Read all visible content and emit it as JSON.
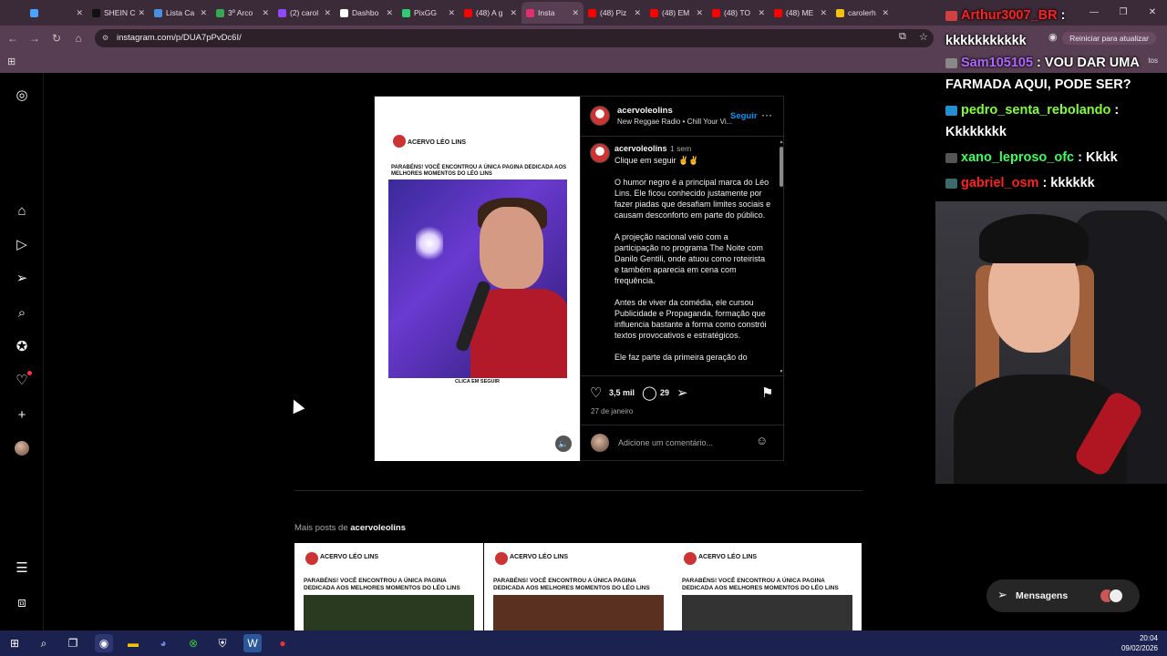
{
  "browser": {
    "tabs": [
      {
        "label": "",
        "color": "#4aa3ff",
        "active": false
      },
      {
        "label": "SHEIN C",
        "color": "#111111",
        "active": false
      },
      {
        "label": "Lista Ca",
        "color": "#4a90e2",
        "active": false
      },
      {
        "label": "3º Arco",
        "color": "#34a853",
        "active": false
      },
      {
        "label": "(2) carol",
        "color": "#9146ff",
        "active": false
      },
      {
        "label": "Dashbo",
        "color": "#ffffff",
        "active": false
      },
      {
        "label": "PixGG",
        "color": "#2ecc71",
        "active": false
      },
      {
        "label": "(48) A g",
        "color": "#ff0000",
        "active": false
      },
      {
        "label": "Insta",
        "color": "#e1306c",
        "active": true
      },
      {
        "label": "(48) Piz",
        "color": "#ff0000",
        "active": false
      },
      {
        "label": "(48) EM",
        "color": "#ff0000",
        "active": false
      },
      {
        "label": "(48) TO",
        "color": "#ff0000",
        "active": false
      },
      {
        "label": "(48) ME",
        "color": "#ff0000",
        "active": false
      },
      {
        "label": "carolerh",
        "color": "#f4c20d",
        "active": false
      }
    ],
    "url": "instagram.com/p/DUA7pPvDc6I/",
    "restart_label": "Reiniciar para atualizar",
    "bookmarks_right": "tos"
  },
  "post": {
    "media": {
      "brand": "ACERVO LÉO LINS",
      "headline": "PARABÉNS! VOCÊ ENCONTROU A ÚNICA PAGINA DEDICADA AOS MELHORES MOMENTOS DO LÉO LINS",
      "cta": "CLICA EM SEGUIR"
    },
    "username": "acervoleolins",
    "audio": "New Reggae Radio • Chill Your Vi...",
    "follow_label": "Seguir",
    "caption": {
      "username": "acervoleolins",
      "time": "1 sem",
      "paragraphs": [
        "Clique em seguir ✌✌",
        "O humor negro é a principal marca do Léo Lins. Ele ficou conhecido justamente por fazer piadas que desafiam limites sociais e causam desconforto em parte do público.",
        "A projeção nacional veio com a participação no programa The Noite com Danilo Gentili, onde atuou como roteirista e também aparecia em cena com frequência.",
        "Antes de viver da comédia, ele cursou Publicidade e Propaganda, formação que influencia bastante a forma como constrói textos provocativos e estratégicos.",
        "Ele faz parte da primeira geração do"
      ]
    },
    "likes": "3,5 mil",
    "comments": "29",
    "date": "27 de janeiro",
    "comment_placeholder": "Adicione um comentário..."
  },
  "more_posts": {
    "prefix": "Mais posts de",
    "user": "acervoleolins",
    "items": [
      {
        "brand": "ACERVO LÉO LINS",
        "headline": "PARABÉNS! VOCÊ ENCONTROU A ÚNICA PAGINA DEDICADA AOS MELHORES MOMENTOS DO LÉO LINS",
        "tone": "#2a3a20"
      },
      {
        "brand": "ACERVO LÉO LINS",
        "headline": "PARABÉNS! VOCÊ ENCONTROU A ÚNICA PAGINA DEDICADA AOS MELHORES MOMENTOS DO LÉO LINS",
        "tone": "#5a3020"
      },
      {
        "brand": "ACERVO LÉO LINS",
        "headline": "PARABÉNS! VOCÊ ENCONTROU A ÚNICA PAGINA DEDICADA AOS MELHORES MOMENTOS DO LÉO LINS",
        "tone": "#333333"
      }
    ]
  },
  "messages_label": "Mensagens",
  "chat": [
    {
      "user": "Arthur3007_BR",
      "user_color": "#ff2020",
      "text": ":"
    },
    {
      "user": "",
      "user_color": "#ffffff",
      "text": "kkkkkkkkkkk"
    },
    {
      "user": "Sam105105",
      "user_color": "#b066ff",
      "text": ": VOU DAR UMA FARMADA AQUI, PODE SER?"
    },
    {
      "user": "pedro_senta_rebolando",
      "user_color": "#7fff3a",
      "text": ": Kkkkkkkk"
    },
    {
      "user": "xano_leproso_ofc",
      "user_color": "#3aff5a",
      "text": ": Kkkk"
    },
    {
      "user": "gabriel_osm",
      "user_color": "#ff2020",
      "text": ": kkkkkk"
    }
  ],
  "clock": {
    "time": "20:04",
    "date": "09/02/2026"
  },
  "colors": {
    "ig_blue": "#0095f6",
    "browser_chrome": "#583e52",
    "taskbar": "#1c2250"
  }
}
